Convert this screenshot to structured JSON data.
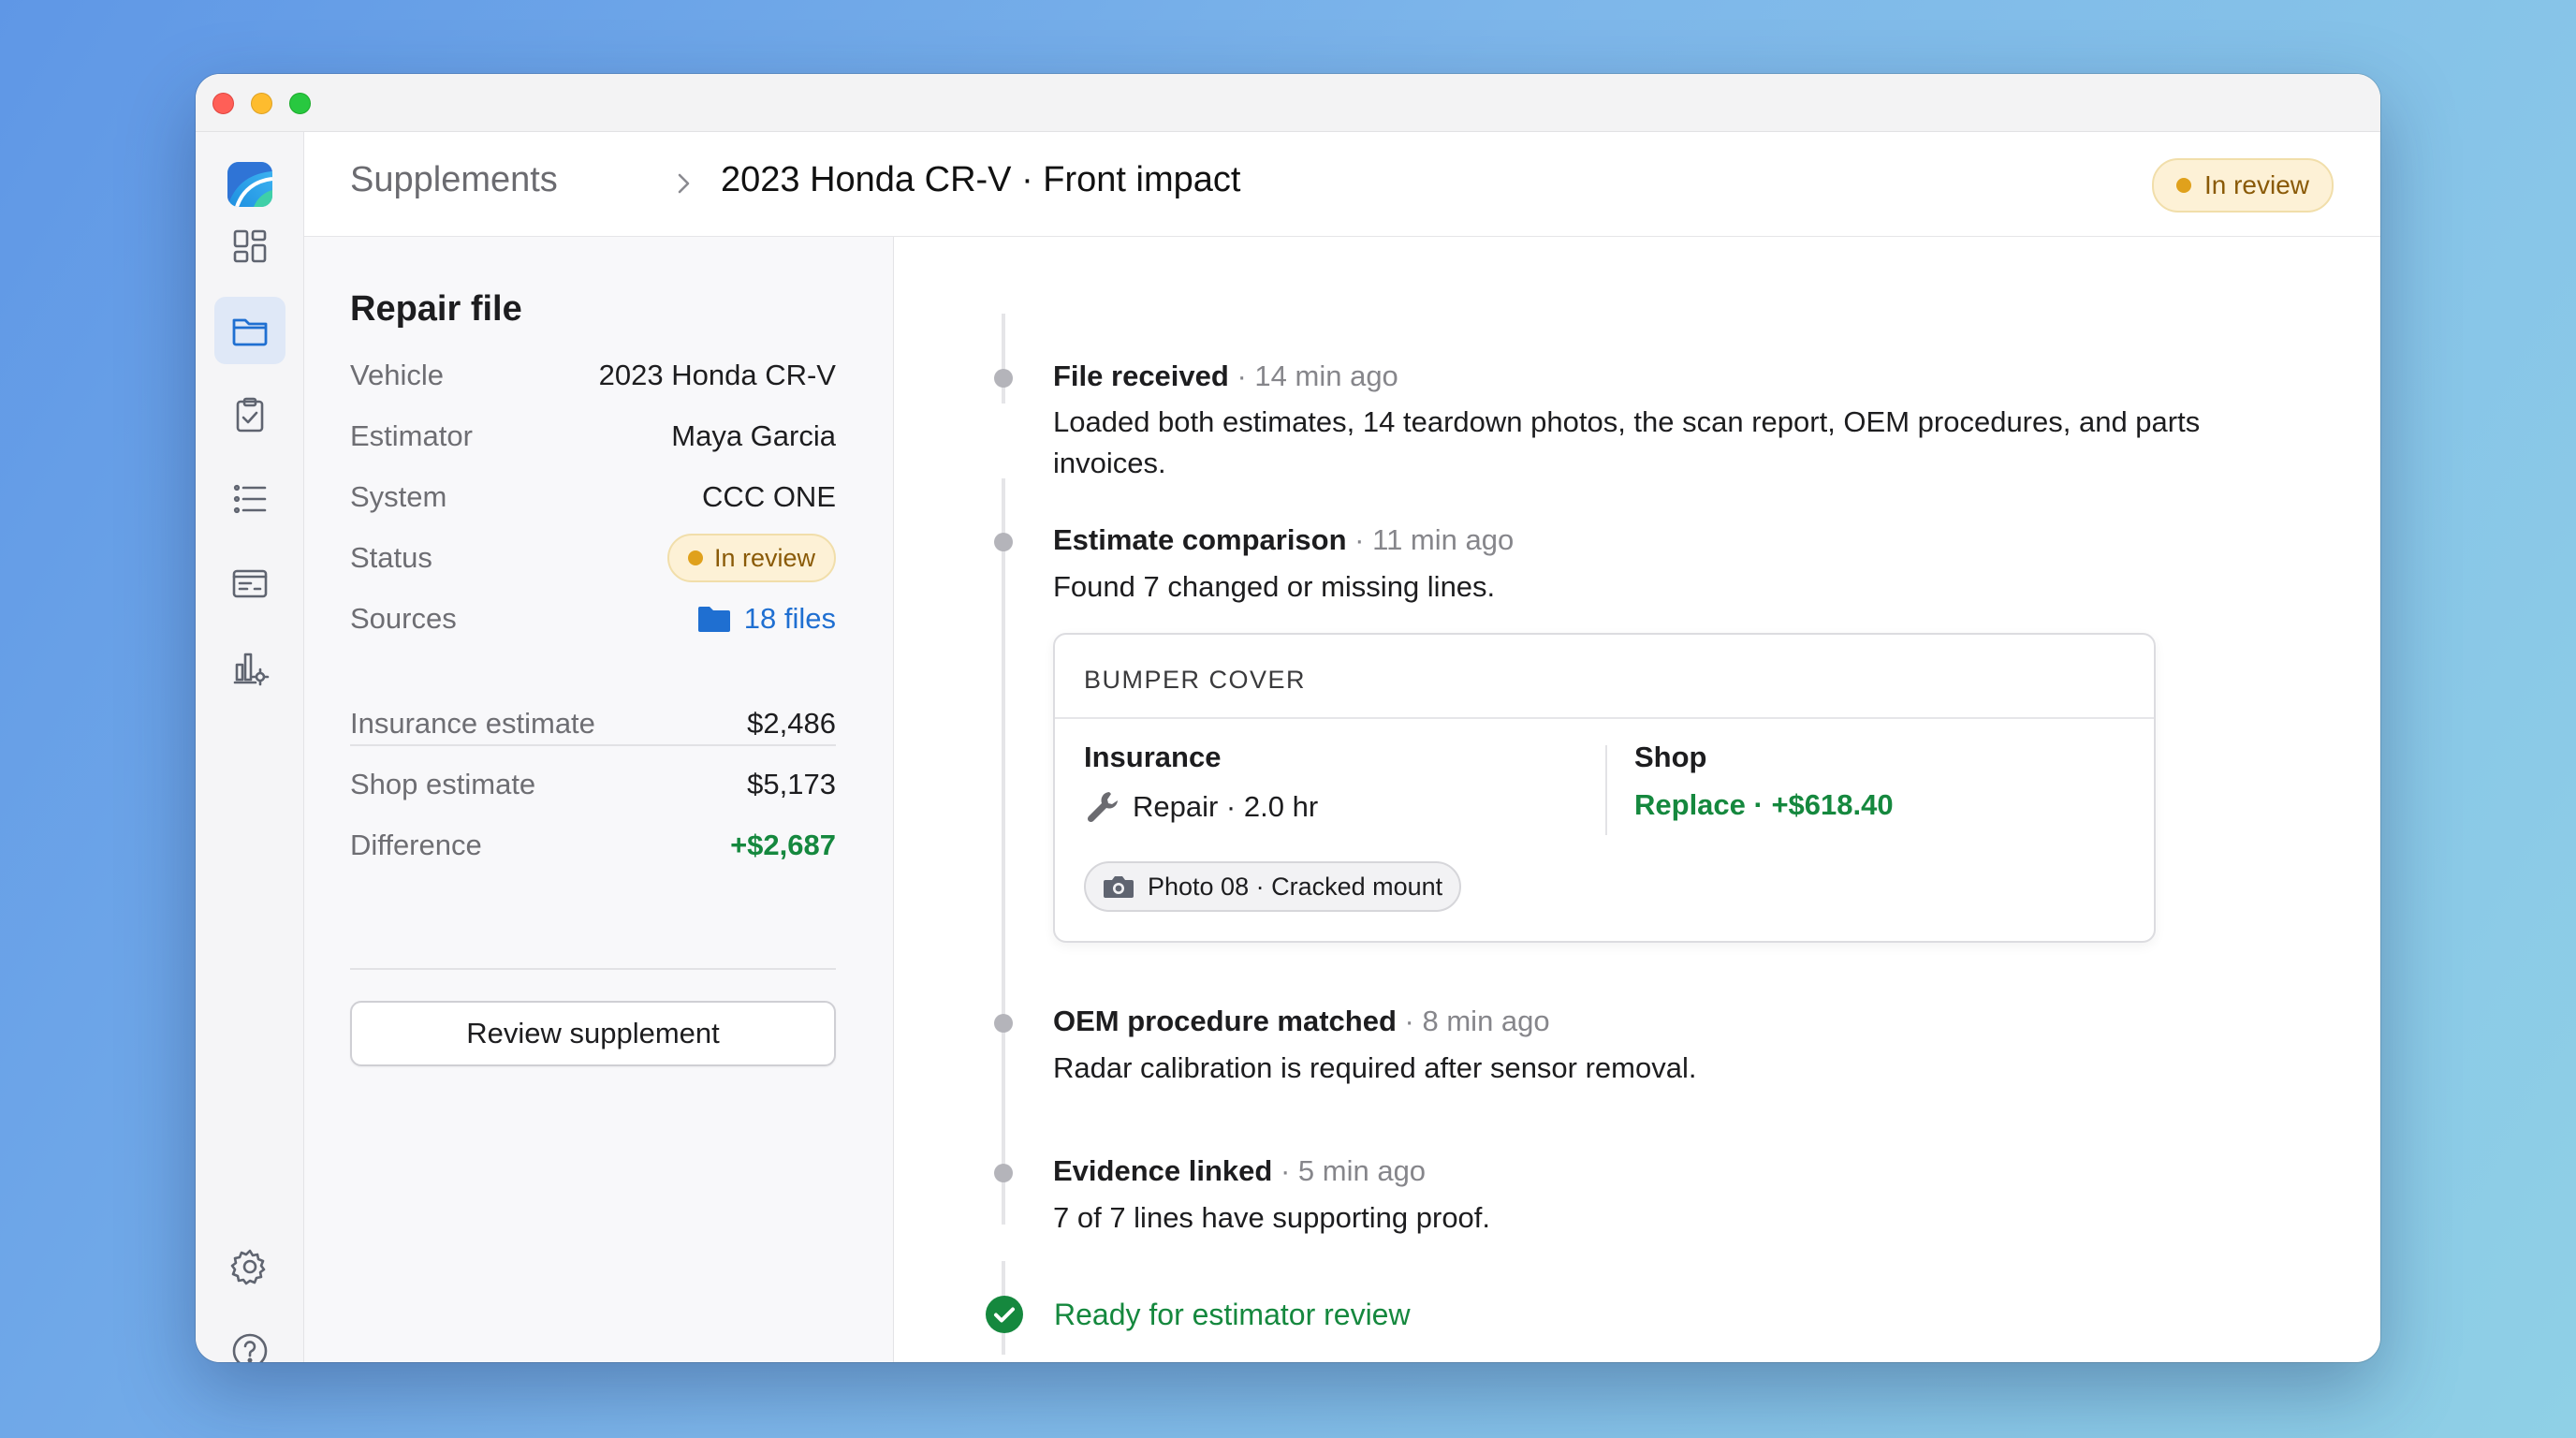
{
  "header": {
    "breadcrumb_parent": "Supplements",
    "breadcrumb_current": "2023 Honda CR-V · Front impact",
    "status": "In review"
  },
  "sidebar": {
    "items": [
      {
        "name": "dashboard-icon"
      },
      {
        "name": "folder-icon",
        "active": true
      },
      {
        "name": "clipboard-check-icon"
      },
      {
        "name": "list-icon"
      },
      {
        "name": "receipt-icon"
      },
      {
        "name": "chart-settings-icon"
      }
    ],
    "bottom": [
      {
        "name": "gear-icon"
      },
      {
        "name": "help-icon"
      }
    ]
  },
  "repair_file": {
    "title": "Repair file",
    "details": [
      {
        "key": "Vehicle",
        "value": "2023 Honda CR-V"
      },
      {
        "key": "Estimator",
        "value": "Maya Garcia"
      },
      {
        "key": "System",
        "value": "CCC ONE"
      },
      {
        "key": "Status",
        "value": "In review"
      },
      {
        "key": "Sources",
        "value": "18 files"
      }
    ],
    "totals": [
      {
        "key": "Insurance estimate",
        "value": "$2,486"
      },
      {
        "key": "Shop estimate",
        "value": "$5,173"
      },
      {
        "key": "Difference",
        "value": "+$2,687"
      }
    ],
    "button": "Review supplement"
  },
  "timeline": {
    "events": [
      {
        "title": "File received",
        "time": "14 min ago",
        "body": "Loaded both estimates, 14 teardown photos, the scan report, OEM procedures, and parts invoices."
      },
      {
        "title": "Estimate comparison",
        "time": "11 min ago",
        "body": "Found 7 changed or missing lines."
      },
      {
        "title": "OEM procedure matched",
        "time": "8 min ago",
        "body": "Radar calibration is required after sensor removal."
      },
      {
        "title": "Evidence linked",
        "time": "5 min ago",
        "body": "7 of 7 lines have supporting proof."
      }
    ],
    "separator": "·",
    "comparison_card": {
      "part": "BUMPER COVER",
      "insurance_label": "Insurance",
      "insurance_detail": "Repair · 2.0 hr",
      "shop_label": "Shop",
      "shop_detail": "Replace · +$618.40",
      "photo": "Photo 08 · Cracked mount"
    },
    "final": "Ready for estimator review"
  },
  "colors": {
    "accent_blue": "#1f6fd1",
    "success_green": "#15883e",
    "warning_amber": "#e0a11c"
  }
}
